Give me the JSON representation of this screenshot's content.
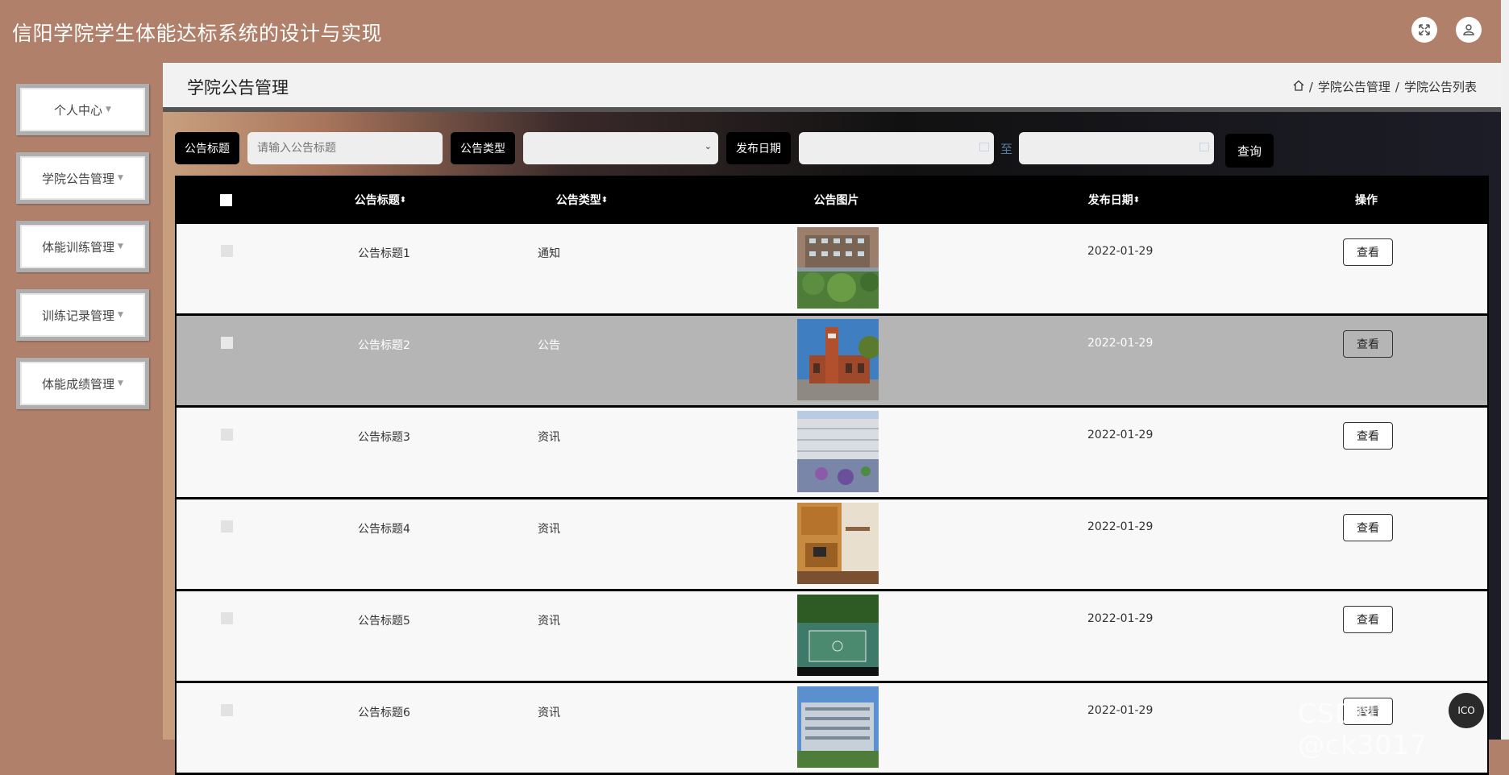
{
  "app": {
    "title": "信阳学院学生体能达标系统的设计与实现"
  },
  "topbar": {
    "fullscreen_icon": "fullscreen-icon",
    "user_icon": "user-icon"
  },
  "sidebar": {
    "items": [
      {
        "label": "个人中心"
      },
      {
        "label": "学院公告管理"
      },
      {
        "label": "体能训练管理"
      },
      {
        "label": "训练记录管理"
      },
      {
        "label": "体能成绩管理"
      }
    ]
  },
  "page": {
    "title": "学院公告管理",
    "breadcrumb": [
      "学院公告管理",
      "学院公告列表"
    ]
  },
  "search": {
    "title_label": "公告标题",
    "title_placeholder": "请输入公告标题",
    "type_label": "公告类型",
    "type_value": "",
    "date_label": "发布日期",
    "date_sep": "至",
    "query_label": "查询"
  },
  "table": {
    "columns": [
      "公告标题",
      "公告类型",
      "公告图片",
      "发布日期",
      "操作"
    ],
    "rows": [
      {
        "title": "公告标题1",
        "type": "通知",
        "date": "2022-01-29",
        "action": "查看",
        "image": "building-photo"
      },
      {
        "title": "公告标题2",
        "type": "公告",
        "date": "2022-01-29",
        "action": "查看",
        "image": "building-photo"
      },
      {
        "title": "公告标题3",
        "type": "资讯",
        "date": "2022-01-29",
        "action": "查看",
        "image": "courtyard-photo"
      },
      {
        "title": "公告标题4",
        "type": "资讯",
        "date": "2022-01-29",
        "action": "查看",
        "image": "dorm-photo"
      },
      {
        "title": "公告标题5",
        "type": "资讯",
        "date": "2022-01-29",
        "action": "查看",
        "image": "court-photo"
      },
      {
        "title": "公告标题6",
        "type": "资讯",
        "date": "2022-01-29",
        "action": "查看",
        "image": "building-photo"
      }
    ]
  },
  "watermark": "CSDN @ck3017",
  "float_button": "ICO"
}
